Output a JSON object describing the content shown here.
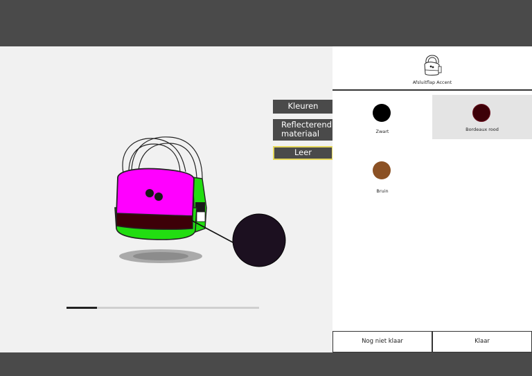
{
  "materials": {
    "items": [
      {
        "label": "Kleuren",
        "active": false
      },
      {
        "label_line1": "Reflecterend",
        "label_line2": "materiaal",
        "active": false
      },
      {
        "label": "Leer",
        "active": true
      }
    ]
  },
  "progress": {
    "value": 0.16
  },
  "part": {
    "label": "Afsluitflap Accent",
    "icon": "backpack-icon"
  },
  "swatches": [
    {
      "label": "Zwart",
      "color": "#000000",
      "selected": false
    },
    {
      "label": "Bordeaux rood",
      "color": "#3d0008",
      "selected": true
    },
    {
      "label": "Bruin",
      "color": "#8b5124",
      "selected": false
    }
  ],
  "footer": {
    "not_ready_label": "Nog niet klaar",
    "ready_label": "Klaar"
  },
  "colors": {
    "bar": "#4a4a4a",
    "stage": "#f1f1f1",
    "flap": "#ff00ff",
    "body": "#22dd11",
    "accent": "#3d0008",
    "zoom": "#1c1020"
  }
}
